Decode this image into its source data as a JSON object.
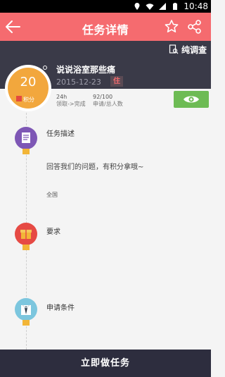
{
  "status_bar": {
    "time": "10:48",
    "icons": [
      "location-icon",
      "wifi-icon",
      "signal-icon",
      "battery-icon"
    ]
  },
  "app_bar": {
    "title": "任务详情"
  },
  "task": {
    "type_label": "纯调查",
    "title": "说说浴室那些痛",
    "date": "2015-12-23",
    "badge": "住",
    "points_value": "20",
    "points_unit": "积分",
    "duration_value": "24h",
    "duration_label": "领取->完成",
    "applicants_value": "92/100",
    "applicants_label": "申请/总人数"
  },
  "sections": {
    "description": {
      "title": "任务描述",
      "body": "回答我们的问题，有积分拿哦~",
      "region": "全国"
    },
    "requirements": {
      "title": "要求"
    },
    "conditions": {
      "title": "申请条件"
    }
  },
  "cta": {
    "label": "立即做任务"
  },
  "colors": {
    "accent": "#f56b6f",
    "dark": "#3a3a48",
    "points": "#f2a73d",
    "action": "#6dbb54",
    "cta": "#2d2d3e"
  }
}
